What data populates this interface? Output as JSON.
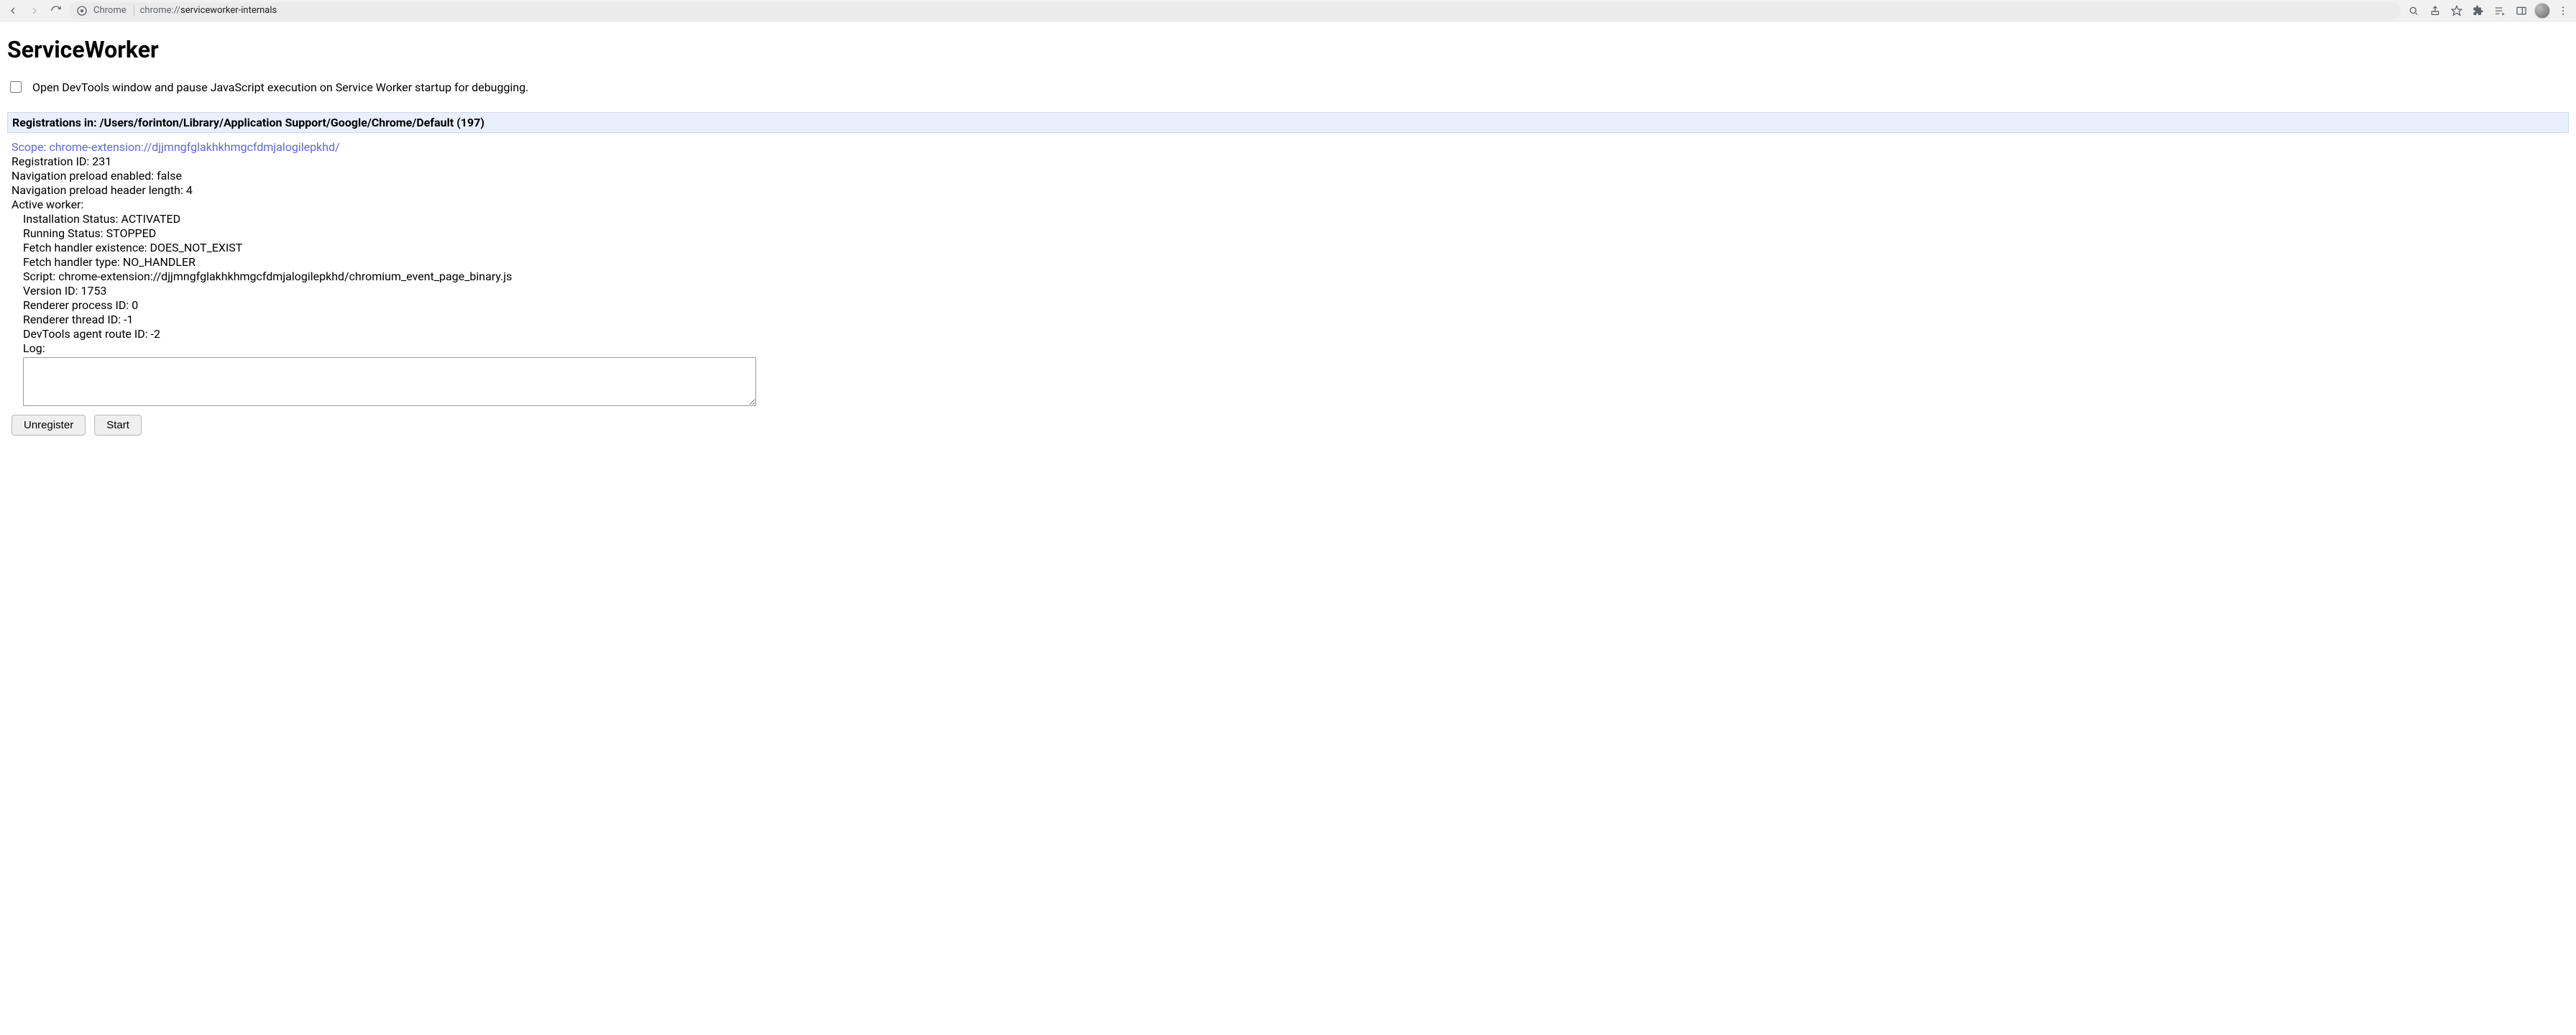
{
  "toolbar": {
    "chrome_label": "Chrome",
    "url_protocol": "chrome://",
    "url_path": "serviceworker-internals"
  },
  "page": {
    "title": "ServiceWorker",
    "debug_checkbox_label": "Open DevTools window and pause JavaScript execution on Service Worker startup for debugging.",
    "reg_header": "Registrations in: /Users/forinton/Library/Application Support/Google/Chrome/Default (197)"
  },
  "scope": {
    "label": "Scope: ",
    "url": "chrome-extension://djjmngfglakhkhmgcfdmjalogilepkhd/"
  },
  "details": {
    "registration_id": "Registration ID: 231",
    "nav_preload_enabled": "Navigation preload enabled: false",
    "nav_preload_header_length": "Navigation preload header length: 4",
    "active_worker": "Active worker:",
    "installation_status": "Installation Status: ACTIVATED",
    "running_status": "Running Status: STOPPED",
    "fetch_handler_existence": "Fetch handler existence: DOES_NOT_EXIST",
    "fetch_handler_type": "Fetch handler type: NO_HANDLER",
    "script": "Script: chrome-extension://djjmngfglakhkhmgcfdmjalogilepkhd/chromium_event_page_binary.js",
    "version_id": "Version ID: 1753",
    "renderer_process_id": "Renderer process ID: 0",
    "renderer_thread_id": "Renderer thread ID: -1",
    "devtools_agent_route_id": "DevTools agent route ID: -2",
    "log_label": "Log:",
    "log_value": ""
  },
  "buttons": {
    "unregister": "Unregister",
    "start": "Start"
  }
}
